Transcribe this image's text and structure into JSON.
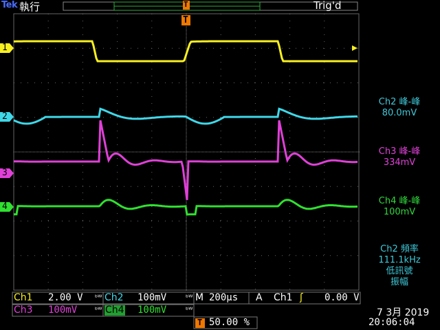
{
  "header": {
    "brand": "Tek",
    "mode": "執行",
    "trigger_status": "Trig'd"
  },
  "markers": {
    "trigger_marker": "T",
    "ch1": "1",
    "ch2": "2",
    "ch3": "3",
    "ch4": "4"
  },
  "measurements": [
    {
      "name": "Ch2 峰-峰",
      "value": "80.0mV",
      "color": "#3fc8d8"
    },
    {
      "name": "Ch3 峰-峰",
      "value": "334mV",
      "color": "#e040d8"
    },
    {
      "name": "Ch4 峰-峰",
      "value": "100mV",
      "color": "#2fd83a"
    }
  ],
  "frequency_readout": {
    "line1": "Ch2 頻率",
    "line2": "111.1kHz",
    "line3": "低訊號",
    "line4": "振幅",
    "color": "#3fc8d8"
  },
  "status": {
    "ch1_label": "Ch1",
    "ch1_scale": "2.00 V",
    "ch2_label": "Ch2",
    "ch2_scale": "100mV",
    "ch3_label": "Ch3",
    "ch3_scale": "100mV",
    "ch4_label": "Ch4",
    "ch4_scale": "100mV",
    "bw_symbol": "ᵇᵂ",
    "time_label": "M",
    "time_scale": "200µs",
    "trig_a": "A",
    "trig_source": "Ch1",
    "trig_slope": "ʃ",
    "trig_level": "0.00 V",
    "trig_pos_marker": "T",
    "trig_position": "50.00 %",
    "date": "7 3月  2019",
    "time": "20:06:04"
  },
  "colors": {
    "ch1": "#f8f020",
    "ch2": "#3fd8e8",
    "ch3": "#e040d8",
    "ch4": "#30e030",
    "trigger": "#f07800",
    "grid": "#555555"
  }
}
